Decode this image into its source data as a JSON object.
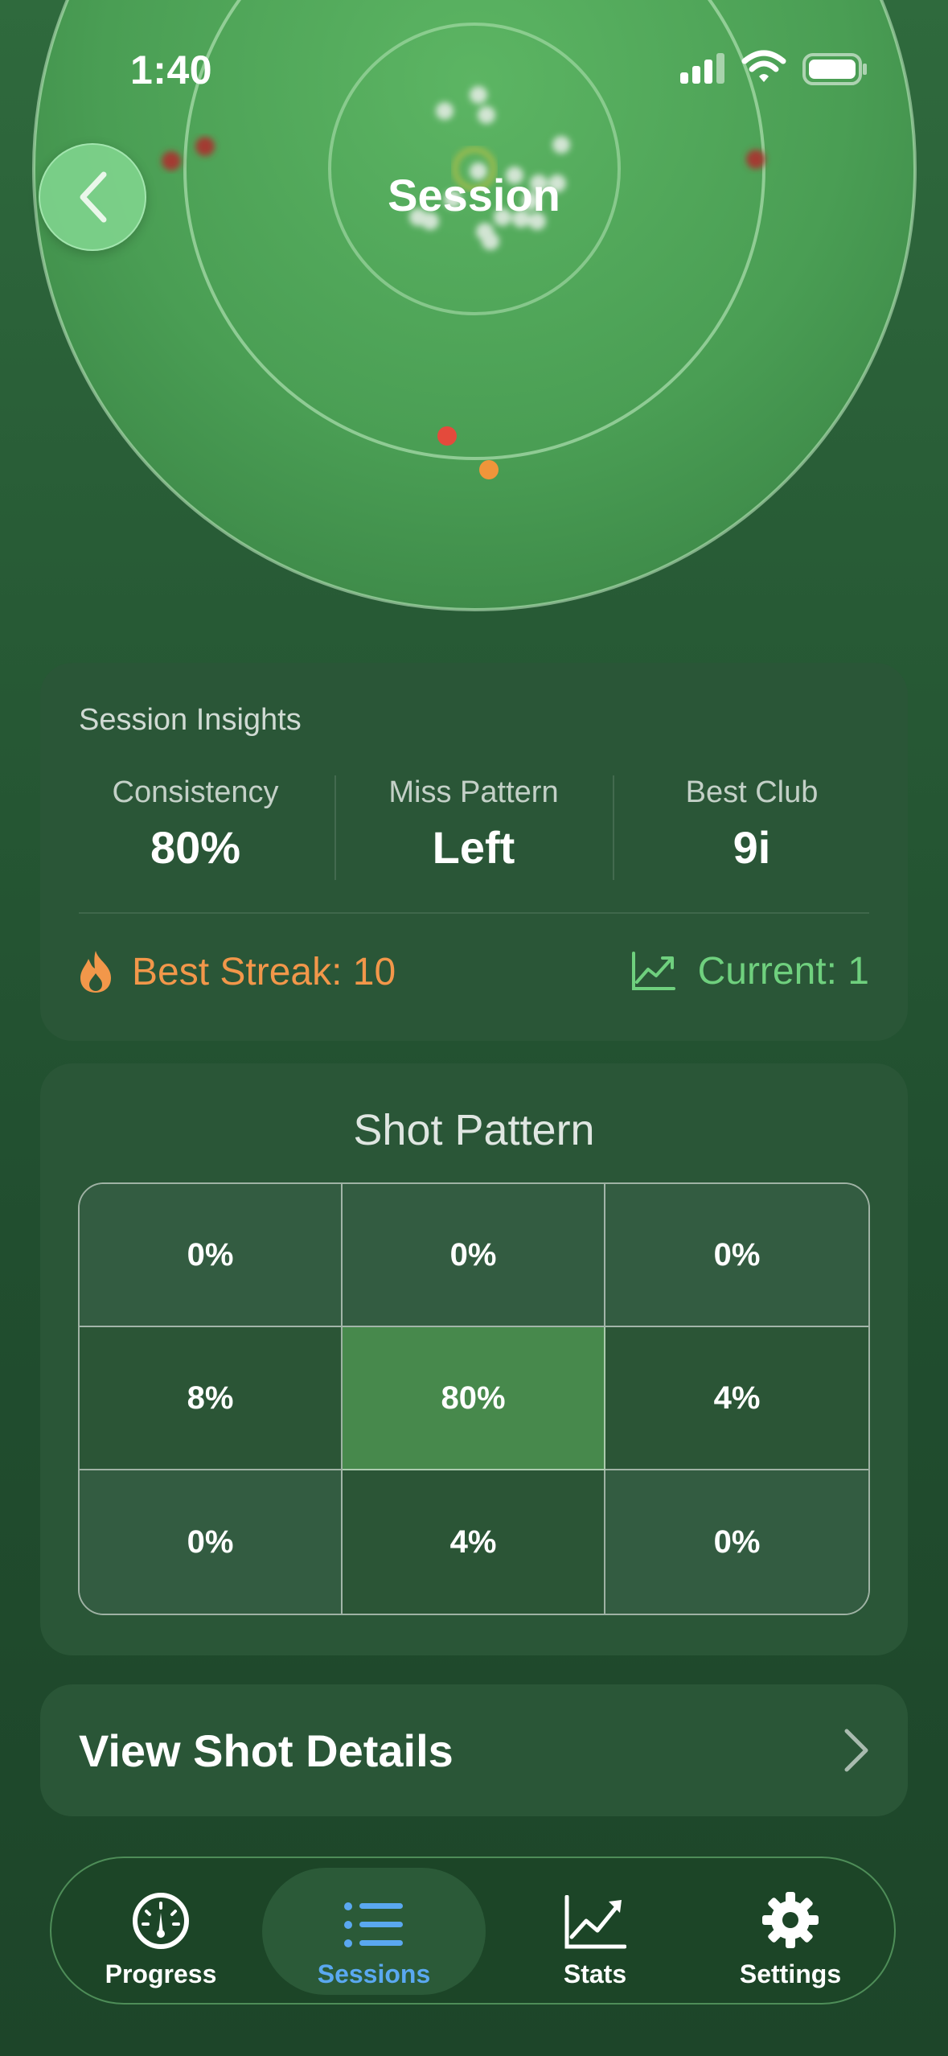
{
  "status_bar": {
    "time": "1:40"
  },
  "header": {
    "title": "Session"
  },
  "insights": {
    "heading": "Session Insights",
    "stats": [
      {
        "label": "Consistency",
        "value": "80%"
      },
      {
        "label": "Miss Pattern",
        "value": "Left"
      },
      {
        "label": "Best Club",
        "value": "9i"
      }
    ],
    "best_streak": "Best Streak: 10",
    "current": "Current: 1"
  },
  "shot_pattern": {
    "title": "Shot Pattern",
    "cells": [
      "0%",
      "0%",
      "0%",
      "8%",
      "80%",
      "4%",
      "0%",
      "4%",
      "0%"
    ]
  },
  "details": {
    "label": "View Shot Details"
  },
  "tabs": [
    {
      "label": "Progress",
      "icon": "gauge-icon"
    },
    {
      "label": "Sessions",
      "icon": "list-icon",
      "active": true
    },
    {
      "label": "Stats",
      "icon": "chart-icon"
    },
    {
      "label": "Settings",
      "icon": "gear-icon"
    }
  ],
  "colors": {
    "accent_orange": "#f2974a",
    "accent_green": "#6fd07e",
    "active_tab_blue": "#5aa8f0",
    "center_cell": "#47894c"
  }
}
